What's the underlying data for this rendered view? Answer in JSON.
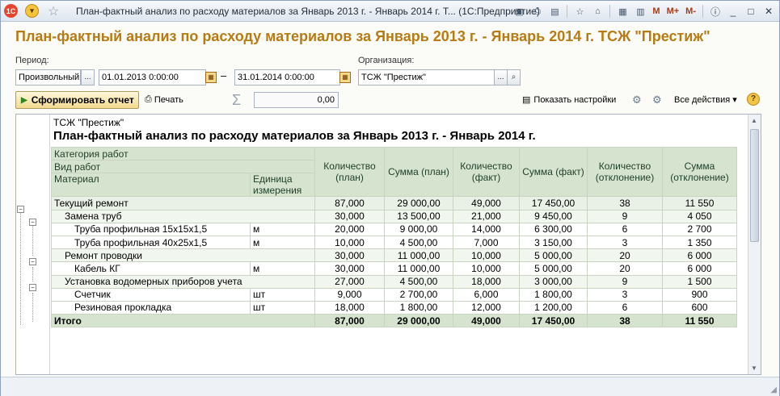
{
  "window": {
    "title": "План-фактный анализ по расходу материалов за Январь 2013 г. - Январь 2014 г. Т...  (1С:Предприятие)",
    "logo": "1С",
    "buttons": {
      "m": "M",
      "mplus": "M+",
      "mminus": "M-"
    }
  },
  "header": {
    "title": "План-фактный анализ по расходу материалов за Январь 2013 г. - Январь 2014 г. ТСЖ \"Престиж\"",
    "period_label": "Период:",
    "period_type": "Произвольный",
    "date_from": "01.01.2013  0:00:00",
    "date_to": "31.01.2014  0:00:00",
    "dash": "–",
    "org_label": "Организация:",
    "org_value": "ТСЖ \"Престиж\""
  },
  "toolbar": {
    "generate": "Сформировать отчет",
    "print": "Печать",
    "sum_value": "0,00",
    "show_settings": "Показать настройки",
    "all_actions": "Все действия ▾",
    "help": "?"
  },
  "report": {
    "org": "ТСЖ \"Престиж\"",
    "title": "План-фактный анализ по расходу материалов за Январь 2013 г. - Январь 2014 г.",
    "head": {
      "cat": "Категория работ",
      "kind": "Вид работ",
      "material": "Материал",
      "unit": "Единица измерения",
      "cols": [
        "Количество (план)",
        "Сумма (план)",
        "Количество (факт)",
        "Сумма (факт)",
        "Количество (отклонение)",
        "Сумма (отклонение)"
      ]
    },
    "rows": [
      {
        "level": 0,
        "name": "Текущий ремонт",
        "unit": "",
        "v": [
          "87,000",
          "29 000,00",
          "49,000",
          "17 450,00",
          "38",
          "11 550"
        ]
      },
      {
        "level": 1,
        "name": "Замена труб",
        "unit": "",
        "v": [
          "30,000",
          "13 500,00",
          "21,000",
          "9 450,00",
          "9",
          "4 050"
        ]
      },
      {
        "level": 2,
        "name": "Труба профильная 15х15х1,5",
        "unit": "м",
        "v": [
          "20,000",
          "9 000,00",
          "14,000",
          "6 300,00",
          "6",
          "2 700"
        ]
      },
      {
        "level": 2,
        "name": "Труба профильная 40х25х1,5",
        "unit": "м",
        "v": [
          "10,000",
          "4 500,00",
          "7,000",
          "3 150,00",
          "3",
          "1 350"
        ]
      },
      {
        "level": 1,
        "name": "Ремонт проводки",
        "unit": "",
        "v": [
          "30,000",
          "11 000,00",
          "10,000",
          "5 000,00",
          "20",
          "6 000"
        ]
      },
      {
        "level": 2,
        "name": "Кабель КГ",
        "unit": "м",
        "v": [
          "30,000",
          "11 000,00",
          "10,000",
          "5 000,00",
          "20",
          "6 000"
        ]
      },
      {
        "level": 1,
        "name": "Установка водомерных приборов учета",
        "unit": "",
        "v": [
          "27,000",
          "4 500,00",
          "18,000",
          "3 000,00",
          "9",
          "1 500"
        ]
      },
      {
        "level": 2,
        "name": "Счетчик",
        "unit": "шт",
        "v": [
          "9,000",
          "2 700,00",
          "6,000",
          "1 800,00",
          "3",
          "900"
        ]
      },
      {
        "level": 2,
        "name": "Резиновая прокладка",
        "unit": "шт",
        "v": [
          "18,000",
          "1 800,00",
          "12,000",
          "1 200,00",
          "6",
          "600"
        ]
      }
    ],
    "total": {
      "name": "Итого",
      "v": [
        "87,000",
        "29 000,00",
        "49,000",
        "17 450,00",
        "38",
        "11 550"
      ]
    }
  }
}
